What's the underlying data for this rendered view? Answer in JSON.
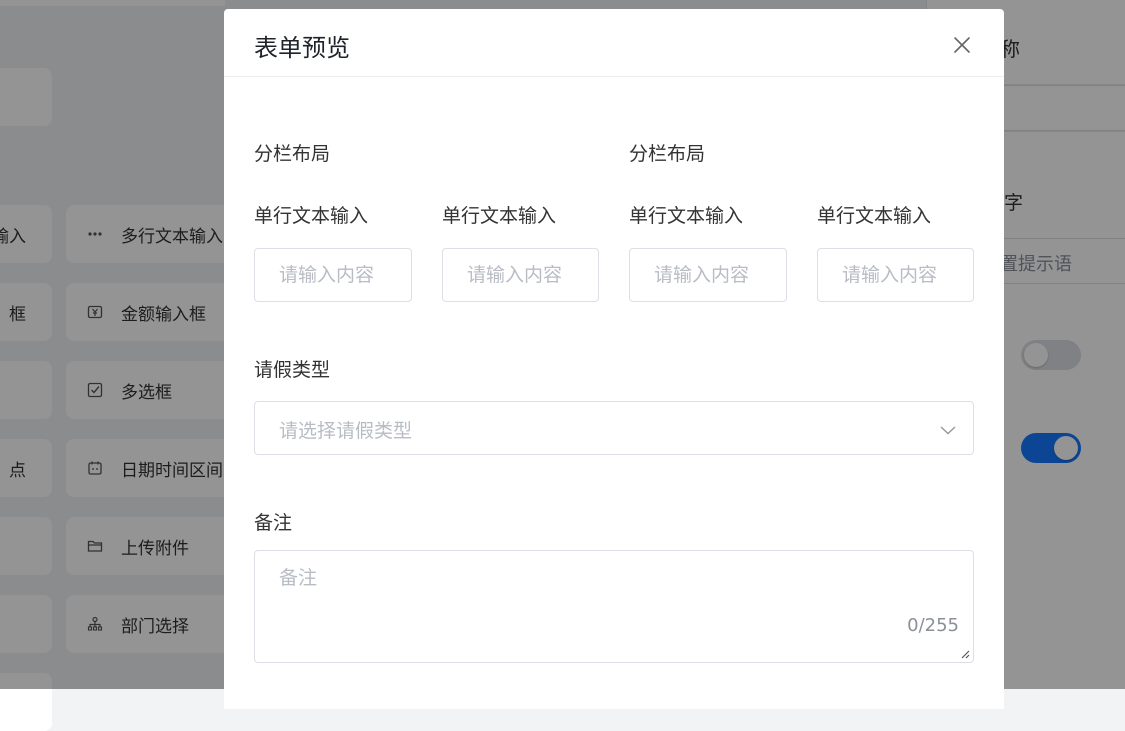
{
  "background": {
    "left_items": [
      {
        "label": "输入"
      },
      {
        "label": "框"
      },
      {
        "label": ""
      },
      {
        "label": "点"
      },
      {
        "label": ""
      },
      {
        "label": ""
      }
    ],
    "components": [
      {
        "label": "多行文本输入",
        "icon": "ellipsis-icon"
      },
      {
        "label": "金额输入框",
        "icon": "money-icon"
      },
      {
        "label": "多选框",
        "icon": "checkbox-icon"
      },
      {
        "label": "日期时间区间",
        "icon": "calendar-icon"
      },
      {
        "label": "上传附件",
        "icon": "folder-icon"
      },
      {
        "label": "部门选择",
        "icon": "org-tree-icon"
      }
    ],
    "right_panel": {
      "title_fragment": "称",
      "label_fragment": "字",
      "placeholder_fragment": "置提示语",
      "toggle_1": false,
      "toggle_2": true
    },
    "colors": {
      "accent": "#1677ff"
    }
  },
  "modal": {
    "title": "表单预览",
    "close_icon": "close-icon",
    "columns": [
      {
        "title": "分栏布局",
        "fields": [
          {
            "label": "单行文本输入",
            "placeholder": "请输入内容"
          },
          {
            "label": "单行文本输入",
            "placeholder": "请输入内容"
          }
        ]
      },
      {
        "title": "分栏布局",
        "fields": [
          {
            "label": "单行文本输入",
            "placeholder": "请输入内容"
          },
          {
            "label": "单行文本输入",
            "placeholder": "请输入内容"
          }
        ]
      }
    ],
    "leave_type": {
      "label": "请假类型",
      "placeholder": "请选择请假类型"
    },
    "remarks": {
      "label": "备注",
      "placeholder": "备注",
      "counter": "0/255"
    }
  }
}
